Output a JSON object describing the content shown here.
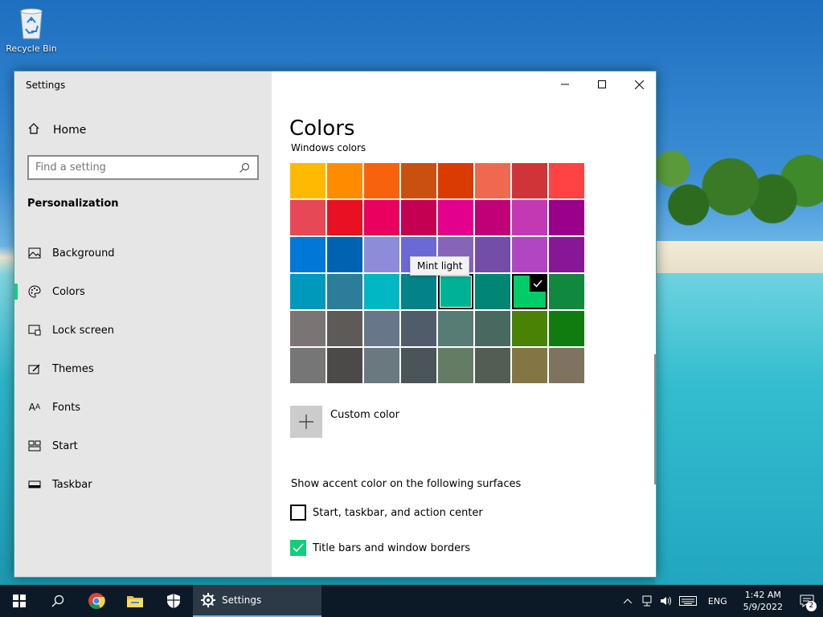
{
  "desktop": {
    "recycle_bin_label": "Recycle Bin"
  },
  "window": {
    "app_title": "Settings",
    "home_label": "Home",
    "search": {
      "placeholder": "Find a setting"
    },
    "section_title": "Personalization",
    "nav_items": [
      {
        "label": "Background",
        "icon": "picture-icon"
      },
      {
        "label": "Colors",
        "icon": "palette-icon",
        "active": true
      },
      {
        "label": "Lock screen",
        "icon": "lock-screen-icon"
      },
      {
        "label": "Themes",
        "icon": "themes-icon"
      },
      {
        "label": "Fonts",
        "icon": "fonts-icon"
      },
      {
        "label": "Start",
        "icon": "start-layout-icon"
      },
      {
        "label": "Taskbar",
        "icon": "taskbar-icon"
      }
    ],
    "controls": {
      "minimize": "minimize-icon",
      "maximize": "maximize-icon",
      "close": "close-icon"
    }
  },
  "content": {
    "page_title": "Colors",
    "windows_colors_label": "Windows colors",
    "swatches": [
      "#FFB900",
      "#FF8C00",
      "#F7630C",
      "#CA5010",
      "#DA3B01",
      "#EF6950",
      "#D13438",
      "#FF4343",
      "#E74856",
      "#E81123",
      "#EA005E",
      "#C30052",
      "#E3008C",
      "#BF0077",
      "#C239B3",
      "#9A0089",
      "#0078D7",
      "#0063B1",
      "#8E8CD8",
      "#6B69D6",
      "#8764B8",
      "#744DA9",
      "#B146C2",
      "#881798",
      "#0099BC",
      "#2D7D9A",
      "#00B7C3",
      "#038387",
      "#00B294",
      "#018574",
      "#00CC6A",
      "#10893E",
      "#7A7574",
      "#5D5A58",
      "#68768A",
      "#515C6B",
      "#567C73",
      "#486860",
      "#498205",
      "#107C10",
      "#767676",
      "#4C4A48",
      "#69797E",
      "#4A5459",
      "#647C64",
      "#525E54",
      "#847545",
      "#7E735F"
    ],
    "selected_index": 30,
    "hovered_index": 28,
    "tooltip": "Mint light",
    "custom_color_label": "Custom color",
    "surfaces_label": "Show accent color on the following surfaces",
    "checkboxes": [
      {
        "label": "Start, taskbar, and action center",
        "checked": false
      },
      {
        "label": "Title bars and window borders",
        "checked": true
      }
    ],
    "accent_color": "#0FD07A"
  },
  "taskbar": {
    "active_app_label": "Settings",
    "language": "ENG",
    "time": "1:42 AM",
    "date": "5/9/2022",
    "notification_count": "2"
  }
}
